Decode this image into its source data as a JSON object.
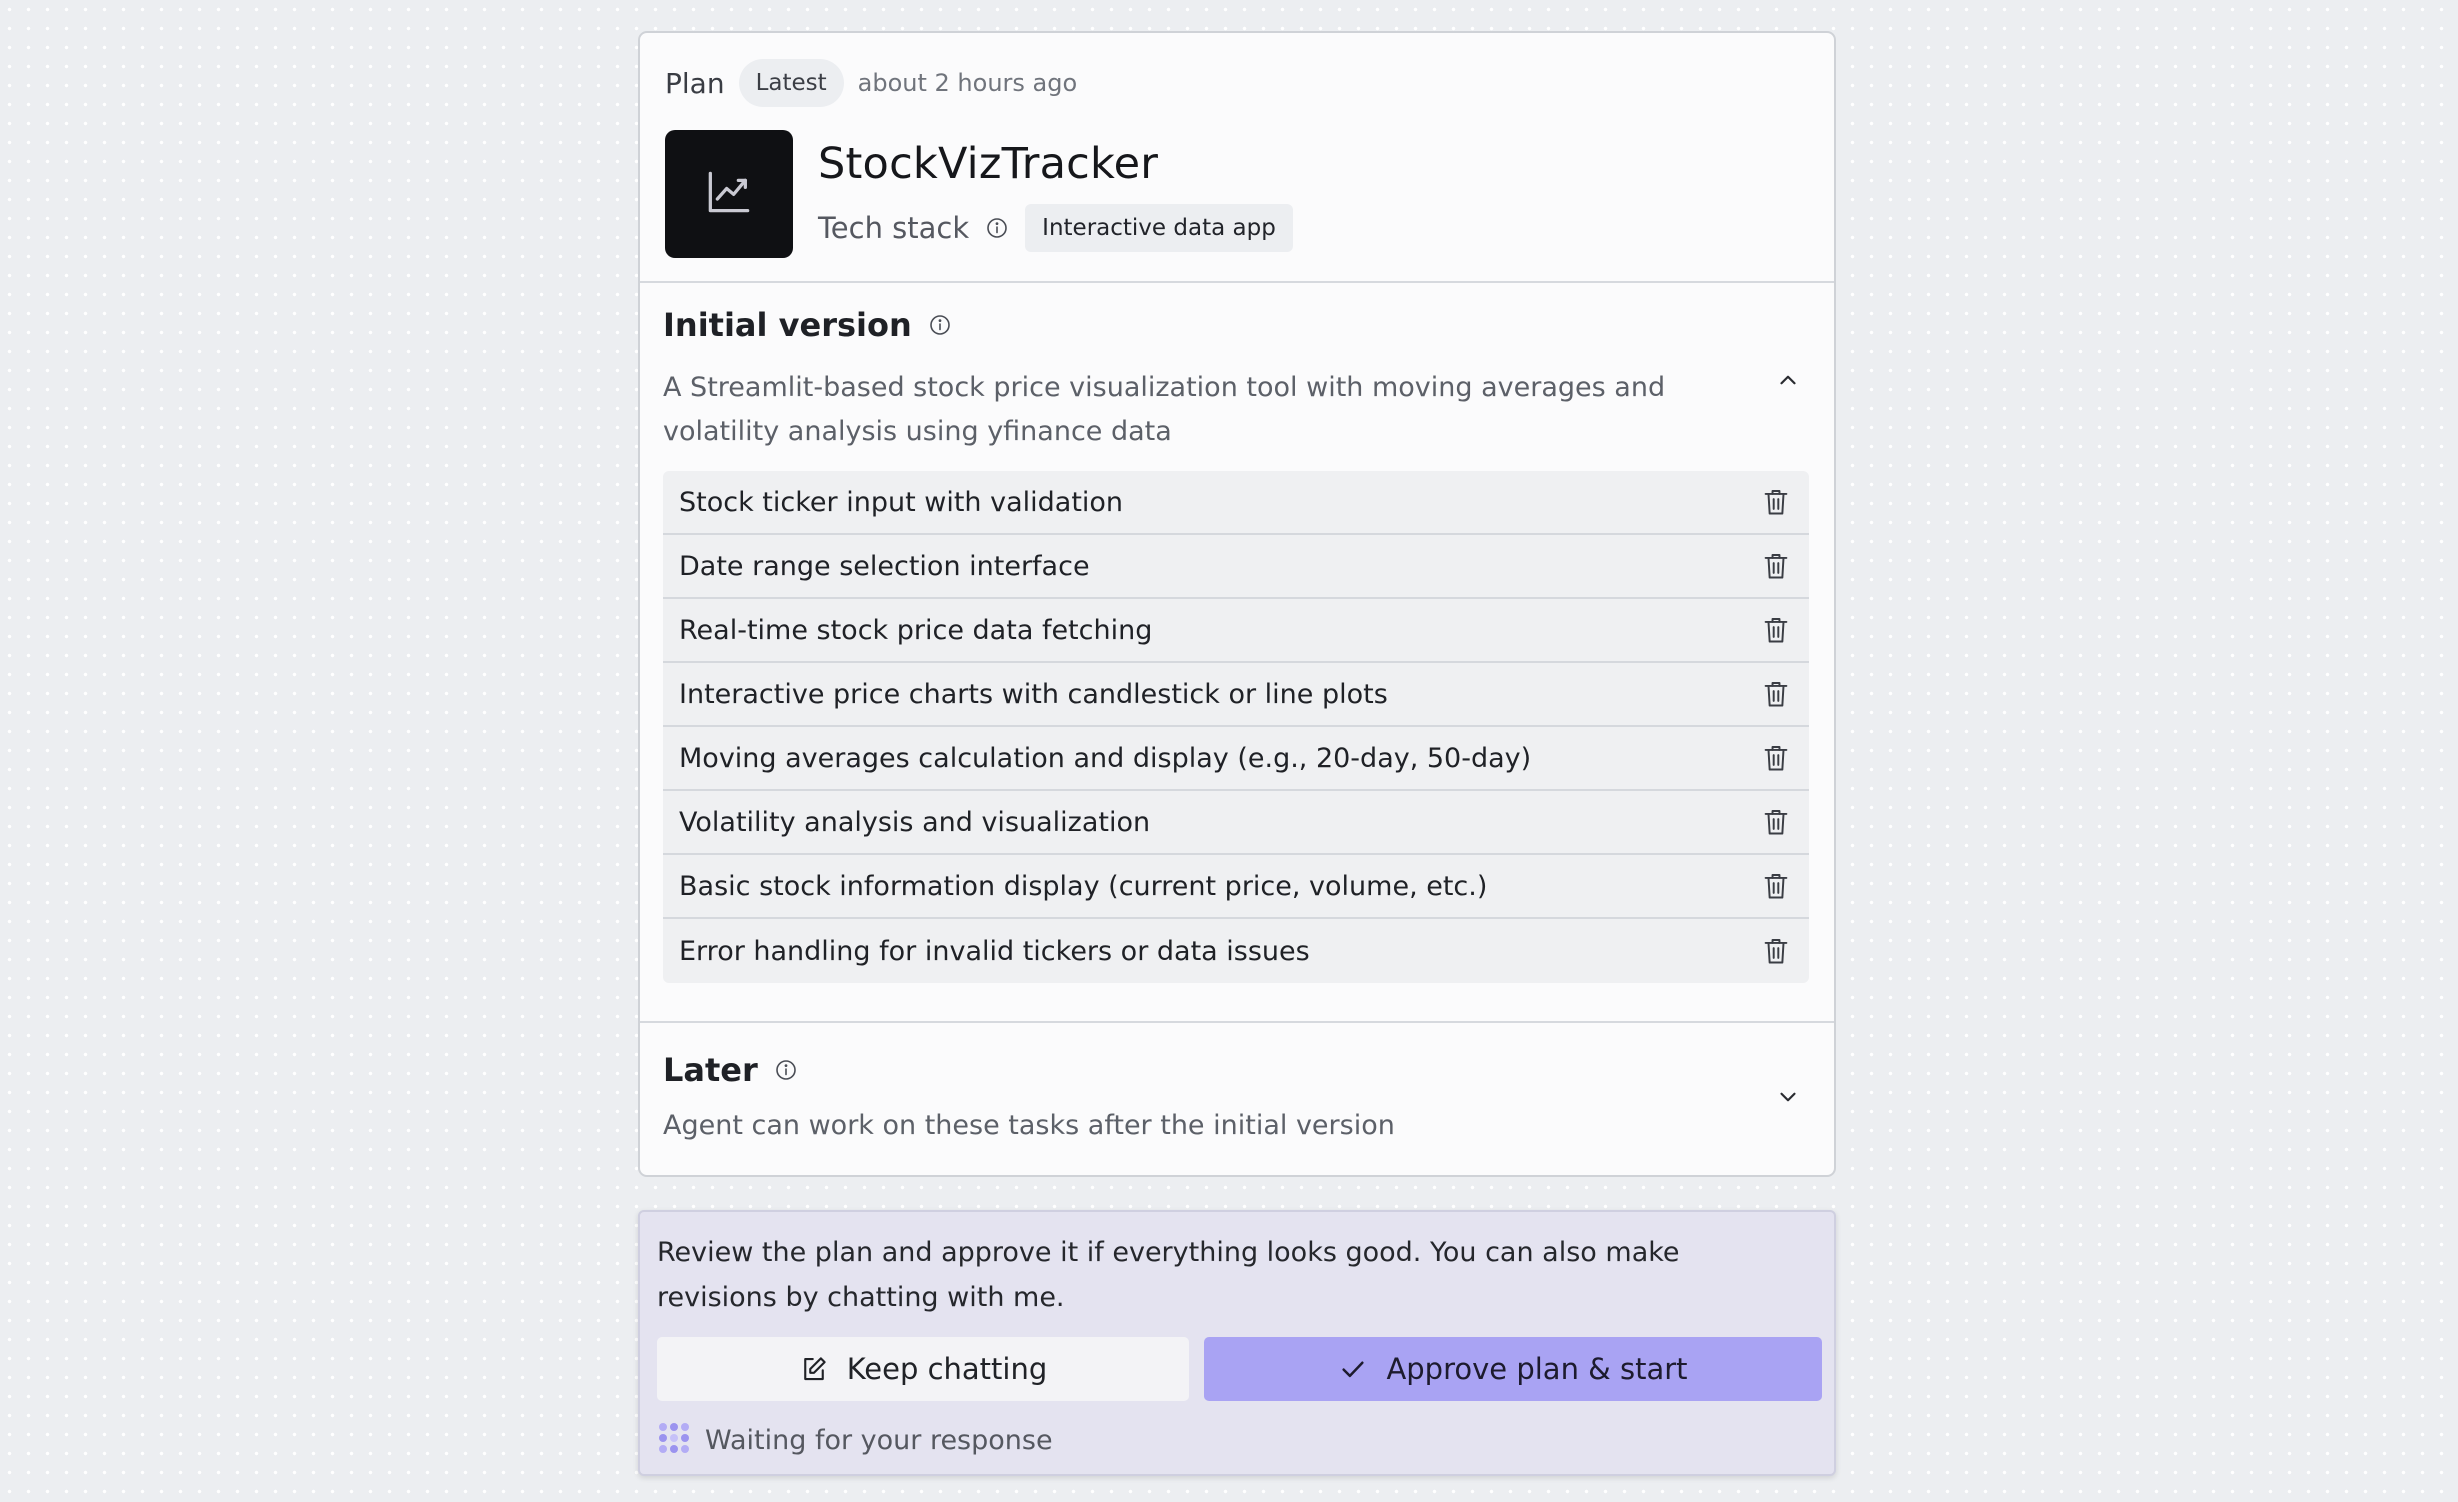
{
  "header": {
    "plan_label": "Plan",
    "latest_badge": "Latest",
    "timestamp": "about 2 hours ago"
  },
  "app": {
    "icon": "chart-line-icon",
    "title": "StockVizTracker",
    "tech_stack_label": "Tech stack",
    "tech_stack_value": "Interactive data app"
  },
  "initial_version": {
    "title": "Initial version",
    "description": "A Streamlit-based stock price visualization tool with moving averages and volatility analysis using yfinance data",
    "expanded": true,
    "features": [
      "Stock ticker input with validation",
      "Date range selection interface",
      "Real-time stock price data fetching",
      "Interactive price charts with candlestick or line plots",
      "Moving averages calculation and display (e.g., 20-day, 50-day)",
      "Volatility analysis and visualization",
      "Basic stock information display (current price, volume, etc.)",
      "Error handling for invalid tickers or data issues"
    ]
  },
  "later": {
    "title": "Later",
    "description": "Agent can work on these tasks after the initial version",
    "expanded": false
  },
  "review": {
    "message": "Review the plan and approve it if everything looks good. You can also make revisions by chatting with me.",
    "keep_chatting_label": "Keep chatting",
    "approve_label": "Approve plan & start",
    "status_text": "Waiting for your response"
  },
  "colors": {
    "accent": "#a9a3f3",
    "panel_background": "#e4e3f0",
    "page_background": "#eceef1",
    "app_icon_background": "#0f1013"
  }
}
